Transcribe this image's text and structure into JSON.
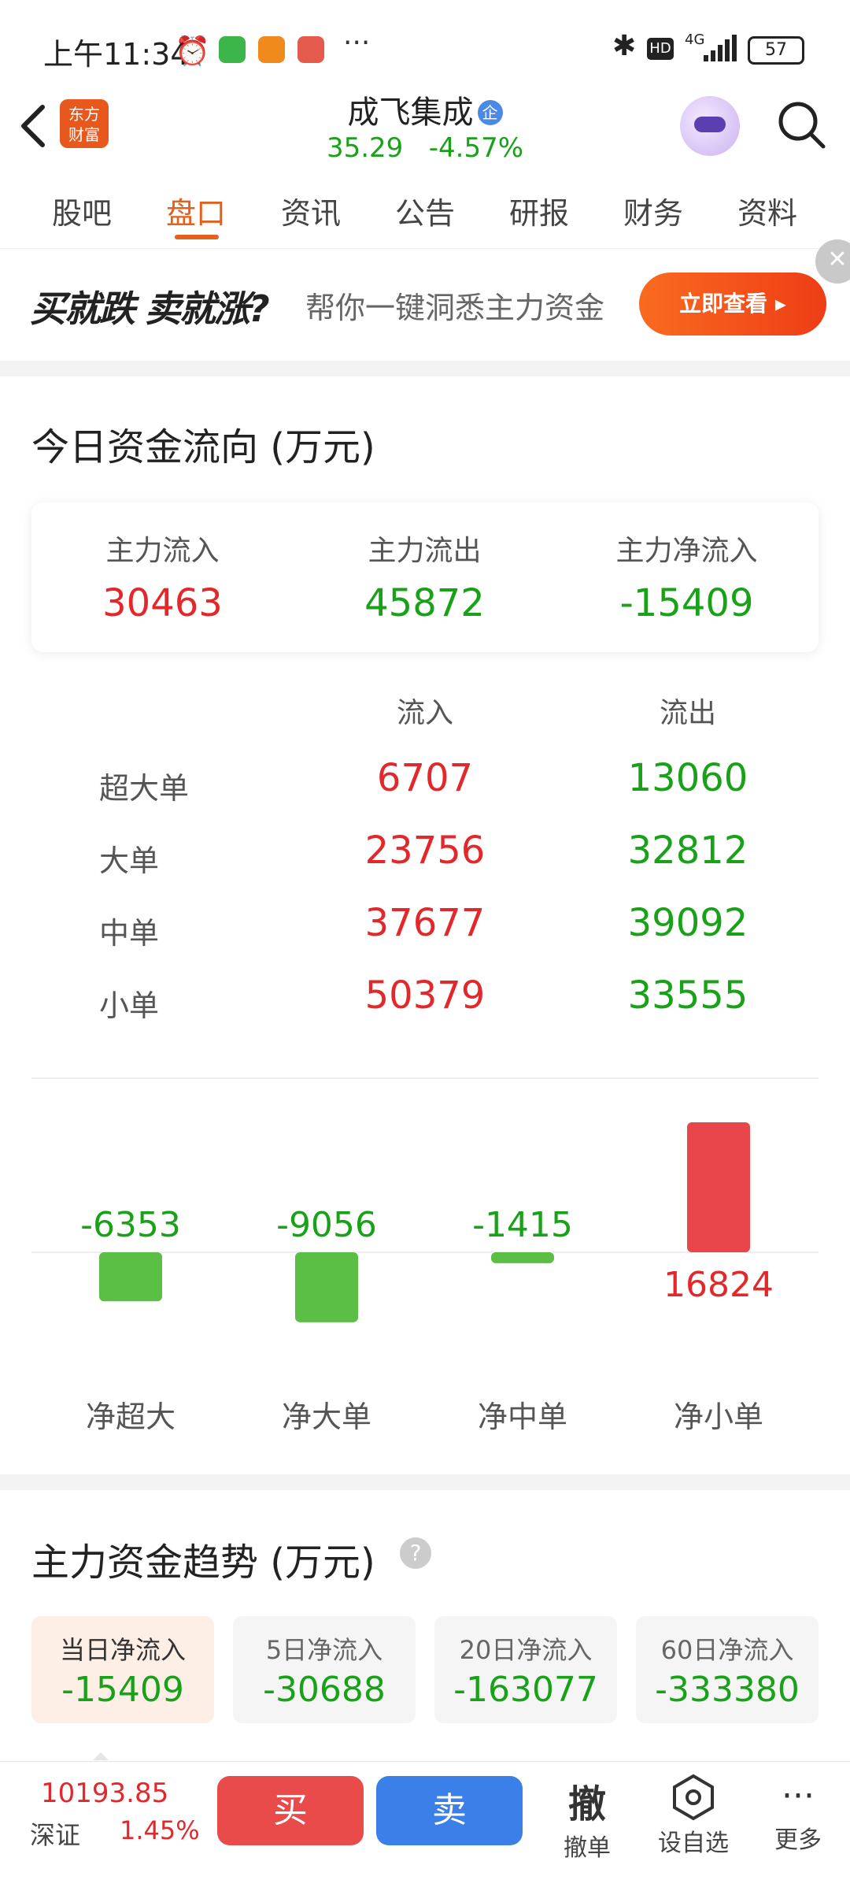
{
  "status_bar": {
    "time": "上午11:34",
    "network": "4G",
    "battery": "57"
  },
  "header": {
    "logo_line1": "东方",
    "logo_line2": "财富",
    "stock_name": "成飞集成",
    "badge": "企",
    "price": "35.29",
    "change_pct": "-4.57%"
  },
  "tabs": [
    {
      "label": "股吧"
    },
    {
      "label": "盘口"
    },
    {
      "label": "资讯"
    },
    {
      "label": "公告"
    },
    {
      "label": "研报"
    },
    {
      "label": "财务"
    },
    {
      "label": "资料"
    }
  ],
  "banner": {
    "slogan": "买就跌 卖就涨?",
    "text": "帮你一键洞悉主力资金",
    "button": "立即查看"
  },
  "fund_flow": {
    "title": "今日资金流向 (万元)",
    "summary": [
      {
        "label": "主力流入",
        "value": "30463"
      },
      {
        "label": "主力流出",
        "value": "45872"
      },
      {
        "label": "主力净流入",
        "value": "-15409"
      }
    ],
    "col_inflow": "流入",
    "col_outflow": "流出",
    "rows": [
      {
        "label": "超大单",
        "inflow": "6707",
        "outflow": "13060"
      },
      {
        "label": "大单",
        "inflow": "23756",
        "outflow": "32812"
      },
      {
        "label": "中单",
        "inflow": "37677",
        "outflow": "39092"
      },
      {
        "label": "小单",
        "inflow": "50379",
        "outflow": "33555"
      }
    ]
  },
  "chart_data": {
    "type": "bar",
    "categories": [
      "净超大",
      "净大单",
      "净中单",
      "净小单"
    ],
    "values": [
      -6353,
      -9056,
      -1415,
      16824
    ],
    "value_labels": [
      "-6353",
      "-9056",
      "-1415",
      "16824"
    ],
    "colors": {
      "positive": "#e8464a",
      "negative": "#5cbf45"
    }
  },
  "trend": {
    "title": "主力资金趋势 (万元)",
    "help": "?",
    "pills": [
      {
        "label": "当日净流入",
        "value": "-15409"
      },
      {
        "label": "5日净流入",
        "value": "-30688"
      },
      {
        "label": "20日净流入",
        "value": "-163077"
      },
      {
        "label": "60日净流入",
        "value": "-333380"
      }
    ]
  },
  "bottom_bar": {
    "index_value": "10193.85",
    "index_name": "深证",
    "index_change": "1.45%",
    "buy": "买",
    "sell": "卖",
    "cancel_icon": "撤",
    "cancel_label": "撤单",
    "watch_label": "设自选",
    "more_label": "更多"
  }
}
